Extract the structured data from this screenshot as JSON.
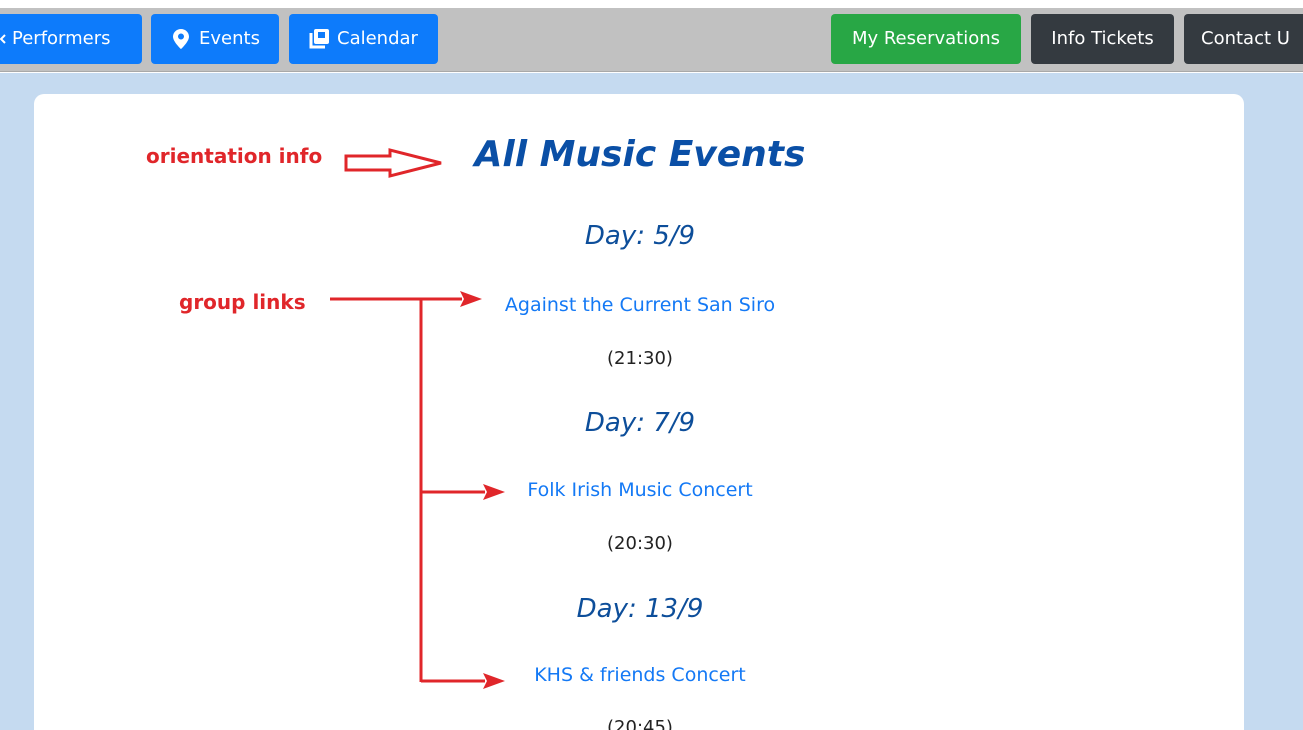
{
  "navbar": {
    "performers_label": "Performers",
    "events_label": "Events",
    "calendar_label": "Calendar",
    "reservations_label": "My Reservations",
    "info_tickets_label": "Info Tickets",
    "contact_label": "Contact U"
  },
  "page": {
    "title": "All Music Events",
    "groups": [
      {
        "day": "Day: 5/9",
        "event": "Against the Current San Siro",
        "time": "(21:30)"
      },
      {
        "day": "Day: 7/9",
        "event": "Folk Irish Music Concert",
        "time": "(20:30)"
      },
      {
        "day": "Day: 13/9",
        "event": "KHS & friends Concert",
        "time": "(20:45)"
      }
    ]
  },
  "annotations": {
    "orientation": "orientation info",
    "group_links": "group links"
  },
  "colors": {
    "annotation": "#e0262a",
    "primary": "#0d7bfb",
    "success": "#28a745",
    "dark": "#343a40",
    "page_bg": "#c5daf0"
  }
}
